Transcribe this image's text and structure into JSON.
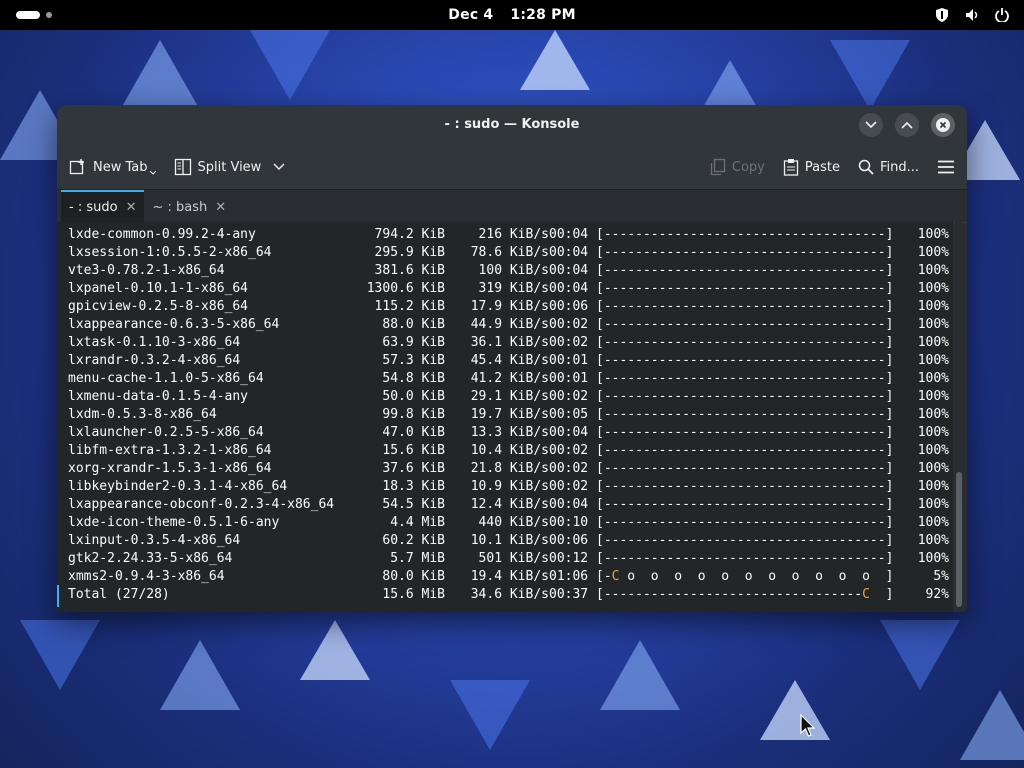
{
  "topbar": {
    "date": "Dec 4",
    "time": "1:28 PM"
  },
  "window": {
    "title": "- : sudo — Konsole"
  },
  "toolbar": {
    "new_tab": "New Tab",
    "split_view": "Split View",
    "copy": "Copy",
    "paste": "Paste",
    "find": "Find..."
  },
  "tabs": [
    {
      "label": "- : sudo",
      "active": true
    },
    {
      "label": "~ : bash",
      "active": false
    }
  ],
  "terminal": {
    "rows": [
      {
        "name": "lxde-common-0.99.2-4-any",
        "size": "794.2 KiB",
        "rate": "216 KiB/s",
        "time": "00:04",
        "bar": "[------------------------------------]",
        "pct": "100%"
      },
      {
        "name": "lxsession-1:0.5.5-2-x86_64",
        "size": "295.9 KiB",
        "rate": "78.6 KiB/s",
        "time": "00:04",
        "bar": "[------------------------------------]",
        "pct": "100%"
      },
      {
        "name": "vte3-0.78.2-1-x86_64",
        "size": "381.6 KiB",
        "rate": "100 KiB/s",
        "time": "00:04",
        "bar": "[------------------------------------]",
        "pct": "100%"
      },
      {
        "name": "lxpanel-0.10.1-1-x86_64",
        "size": "1300.6 KiB",
        "rate": "319 KiB/s",
        "time": "00:04",
        "bar": "[------------------------------------]",
        "pct": "100%"
      },
      {
        "name": "gpicview-0.2.5-8-x86_64",
        "size": "115.2 KiB",
        "rate": "17.9 KiB/s",
        "time": "00:06",
        "bar": "[------------------------------------]",
        "pct": "100%"
      },
      {
        "name": "lxappearance-0.6.3-5-x86_64",
        "size": "88.0 KiB",
        "rate": "44.9 KiB/s",
        "time": "00:02",
        "bar": "[------------------------------------]",
        "pct": "100%"
      },
      {
        "name": "lxtask-0.1.10-3-x86_64",
        "size": "63.9 KiB",
        "rate": "36.1 KiB/s",
        "time": "00:02",
        "bar": "[------------------------------------]",
        "pct": "100%"
      },
      {
        "name": "lxrandr-0.3.2-4-x86_64",
        "size": "57.3 KiB",
        "rate": "45.4 KiB/s",
        "time": "00:01",
        "bar": "[------------------------------------]",
        "pct": "100%"
      },
      {
        "name": "menu-cache-1.1.0-5-x86_64",
        "size": "54.8 KiB",
        "rate": "41.2 KiB/s",
        "time": "00:01",
        "bar": "[------------------------------------]",
        "pct": "100%"
      },
      {
        "name": "lxmenu-data-0.1.5-4-any",
        "size": "50.0 KiB",
        "rate": "29.1 KiB/s",
        "time": "00:02",
        "bar": "[------------------------------------]",
        "pct": "100%"
      },
      {
        "name": "lxdm-0.5.3-8-x86_64",
        "size": "99.8 KiB",
        "rate": "19.7 KiB/s",
        "time": "00:05",
        "bar": "[------------------------------------]",
        "pct": "100%"
      },
      {
        "name": "lxlauncher-0.2.5-5-x86_64",
        "size": "47.0 KiB",
        "rate": "13.3 KiB/s",
        "time": "00:04",
        "bar": "[------------------------------------]",
        "pct": "100%"
      },
      {
        "name": "libfm-extra-1.3.2-1-x86_64",
        "size": "15.6 KiB",
        "rate": "10.4 KiB/s",
        "time": "00:02",
        "bar": "[------------------------------------]",
        "pct": "100%"
      },
      {
        "name": "xorg-xrandr-1.5.3-1-x86_64",
        "size": "37.6 KiB",
        "rate": "21.8 KiB/s",
        "time": "00:02",
        "bar": "[------------------------------------]",
        "pct": "100%"
      },
      {
        "name": "libkeybinder2-0.3.1-4-x86_64",
        "size": "18.3 KiB",
        "rate": "10.9 KiB/s",
        "time": "00:02",
        "bar": "[------------------------------------]",
        "pct": "100%"
      },
      {
        "name": "lxappearance-obconf-0.2.3-4-x86_64",
        "size": "54.5 KiB",
        "rate": "12.4 KiB/s",
        "time": "00:04",
        "bar": "[------------------------------------]",
        "pct": "100%"
      },
      {
        "name": "lxde-icon-theme-0.5.1-6-any",
        "size": "4.4 MiB",
        "rate": "440 KiB/s",
        "time": "00:10",
        "bar": "[------------------------------------]",
        "pct": "100%"
      },
      {
        "name": "lxinput-0.3.5-4-x86_64",
        "size": "60.2 KiB",
        "rate": "10.1 KiB/s",
        "time": "00:06",
        "bar": "[------------------------------------]",
        "pct": "100%"
      },
      {
        "name": "gtk2-2.24.33-5-x86_64",
        "size": "5.7 MiB",
        "rate": "501 KiB/s",
        "time": "00:12",
        "bar": "[------------------------------------]",
        "pct": "100%"
      }
    ],
    "xmms_row": {
      "name": "xmms2-0.9.4-3-x86_64",
      "size": "80.0 KiB",
      "rate": "19.4 KiB/s",
      "time": "01:06",
      "bar_open": "[-",
      "bar_marker": "C",
      "bar_rest": " o  o  o  o  o  o  o  o  o  o  o  ]",
      "pct": "5%"
    },
    "total_row": {
      "name": "Total (27/28)",
      "size": "15.6 MiB",
      "rate": "34.6 KiB/s",
      "time": "00:37",
      "bar_open": "[---------------------------------",
      "bar_marker": "C",
      "bar_rest": "  ]",
      "pct": "92%"
    }
  },
  "colors": {
    "accent": "#3daee9",
    "pacman": "#f3a234"
  }
}
